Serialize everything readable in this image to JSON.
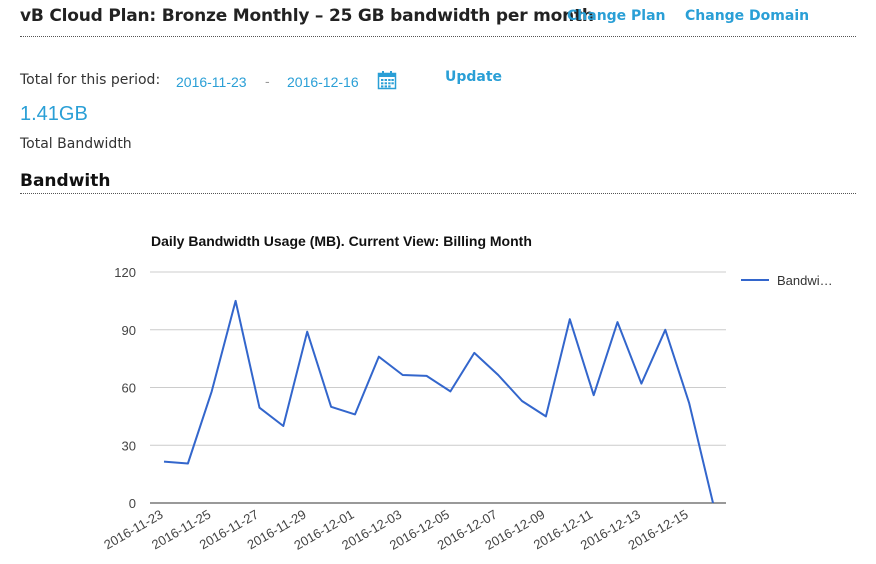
{
  "header": {
    "plan_title": "vB Cloud Plan: Bronze Monthly – 25 GB bandwidth per month",
    "change_plan_label": "Change Plan",
    "change_domain_label": "Change Domain"
  },
  "period": {
    "label": "Total for this period:",
    "start_date": "2016-11-23",
    "separator": "-",
    "end_date": "2016-12-16",
    "update_label": "Update"
  },
  "summary": {
    "total_value": "1.41GB",
    "total_label": "Total Bandwidth"
  },
  "section": {
    "title": "Bandwith"
  },
  "colors": {
    "accent": "#2a9fd6",
    "series": "#3366cc"
  },
  "chart_data": {
    "type": "line",
    "title": "Daily Bandwidth Usage (MB). Current View: Billing Month",
    "xlabel": "",
    "ylabel": "",
    "ylim": [
      0,
      120
    ],
    "yticks": [
      0,
      30,
      60,
      90,
      120
    ],
    "x": [
      "2016-11-23",
      "2016-11-24",
      "2016-11-25",
      "2016-11-26",
      "2016-11-27",
      "2016-11-28",
      "2016-11-29",
      "2016-11-30",
      "2016-12-01",
      "2016-12-02",
      "2016-12-03",
      "2016-12-04",
      "2016-12-05",
      "2016-12-06",
      "2016-12-07",
      "2016-12-08",
      "2016-12-09",
      "2016-12-10",
      "2016-12-11",
      "2016-12-12",
      "2016-12-13",
      "2016-12-14",
      "2016-12-15",
      "2016-12-16"
    ],
    "xtick_labels": [
      "2016-11-23",
      "2016-11-25",
      "2016-11-27",
      "2016-11-29",
      "2016-12-01",
      "2016-12-03",
      "2016-12-05",
      "2016-12-07",
      "2016-12-09",
      "2016-12-11",
      "2016-12-13",
      "2016-12-15"
    ],
    "series": [
      {
        "name": "Bandwi…",
        "values": [
          21.5,
          20.5,
          58,
          105,
          49.5,
          40,
          89,
          50,
          46,
          76,
          66.5,
          66,
          58,
          78,
          66.5,
          53,
          45,
          95.5,
          56,
          94,
          62,
          90,
          52,
          0
        ]
      }
    ],
    "legend": "right",
    "grid": true
  }
}
